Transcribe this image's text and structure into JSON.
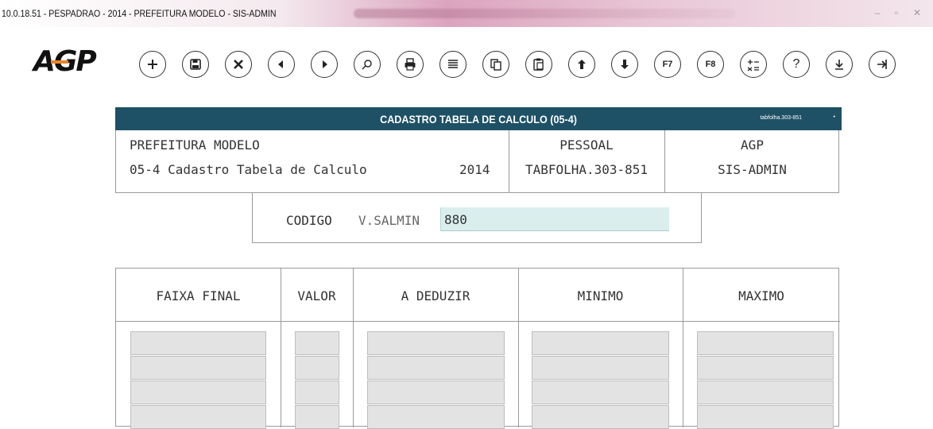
{
  "window": {
    "title": "10.0.18.51 - PESPADRAO - 2014 - PREFEITURA MODELO - SIS-ADMIN"
  },
  "logo": {
    "text": "AGP"
  },
  "toolbar": {
    "buttons": [
      {
        "name": "add-icon",
        "glyph": "+"
      },
      {
        "name": "save-icon",
        "glyph": "💾"
      },
      {
        "name": "delete-icon",
        "glyph": "✕"
      },
      {
        "name": "previous-icon",
        "glyph": "◀"
      },
      {
        "name": "next-icon",
        "glyph": "▶"
      },
      {
        "name": "search-icon",
        "glyph": "⚲"
      },
      {
        "name": "print-icon",
        "glyph": "⎙"
      },
      {
        "name": "list-icon",
        "glyph": "≡"
      },
      {
        "name": "copy-icon",
        "glyph": "⧉"
      },
      {
        "name": "paste-icon",
        "glyph": "📋"
      },
      {
        "name": "arrow-up-icon",
        "glyph": "↑"
      },
      {
        "name": "arrow-down-icon",
        "glyph": "↓"
      },
      {
        "name": "f7-icon",
        "glyph": "F7"
      },
      {
        "name": "f8-icon",
        "glyph": "F8"
      },
      {
        "name": "calculator-icon",
        "glyph": "±"
      },
      {
        "name": "help-icon",
        "glyph": "?"
      },
      {
        "name": "download-icon",
        "glyph": "⤓"
      },
      {
        "name": "exit-icon",
        "glyph": "⇥"
      }
    ]
  },
  "header": {
    "title": "CADASTRO TABELA DE CALCULO (05-4)",
    "code": "tabfolha.303-851",
    "accent_color": "#1e5165"
  },
  "info": {
    "org": "PREFEITURA MODELO",
    "screen": "05-4 Cadastro Tabela de Calculo",
    "year": "2014",
    "module": "PESSOAL",
    "program": "TABFOLHA.303-851",
    "vendor": "AGP",
    "system": "SIS-ADMIN"
  },
  "codigo": {
    "label": "CODIGO",
    "key": "V.SALMIN",
    "value": "880"
  },
  "table": {
    "columns": [
      "FAIXA FINAL",
      "VALOR",
      "A DEDUZIR",
      "MINIMO",
      "MAXIMO"
    ],
    "rows": [
      [
        "",
        "",
        "",
        "",
        ""
      ],
      [
        "",
        "",
        "",
        "",
        ""
      ],
      [
        "",
        "",
        "",
        "",
        ""
      ],
      [
        "",
        "",
        "",
        "",
        ""
      ]
    ]
  }
}
